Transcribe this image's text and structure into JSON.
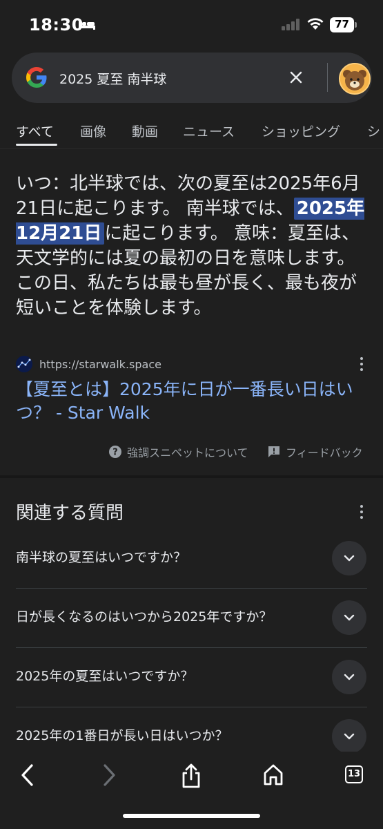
{
  "status_bar": {
    "time": "18:30",
    "battery": "77"
  },
  "search": {
    "query": "2025 夏至 南半球"
  },
  "tabs": [
    {
      "label": "すべて"
    },
    {
      "label": "画像"
    },
    {
      "label": "動画"
    },
    {
      "label": "ニュース"
    },
    {
      "label": "ショッピング"
    },
    {
      "label": "シ"
    }
  ],
  "snippet": {
    "part1": "いつ：北半球では、次の夏至は2025年6月21日に起こります。 南半球では、",
    "highlight": "2025年12月21日",
    "part2": "に起こります。 意味：夏至は、天文学的には夏の最初の日を意味します。 この日、私たちは最も昼が長く、最も夜が短いことを体験します。"
  },
  "source": {
    "url": "https://starwalk.space",
    "title": "【夏至とは】2025年に日が一番長い日はいつ？ - Star Walk"
  },
  "feedback": {
    "about": "強調スニペットについて",
    "feedback": "フィードバック"
  },
  "related": {
    "title": "関連する質問",
    "questions": [
      "南半球の夏至はいつですか？",
      "日が長くなるのはいつから2025年ですか？",
      "2025年の夏至はいつですか？",
      "2025年の1番日が長い日はいつか？"
    ]
  },
  "toolbar": {
    "tab_count": "13"
  },
  "colors": {
    "background": "#1f1f1f",
    "link": "#8ab4f8",
    "highlight": "#2f4d93"
  }
}
